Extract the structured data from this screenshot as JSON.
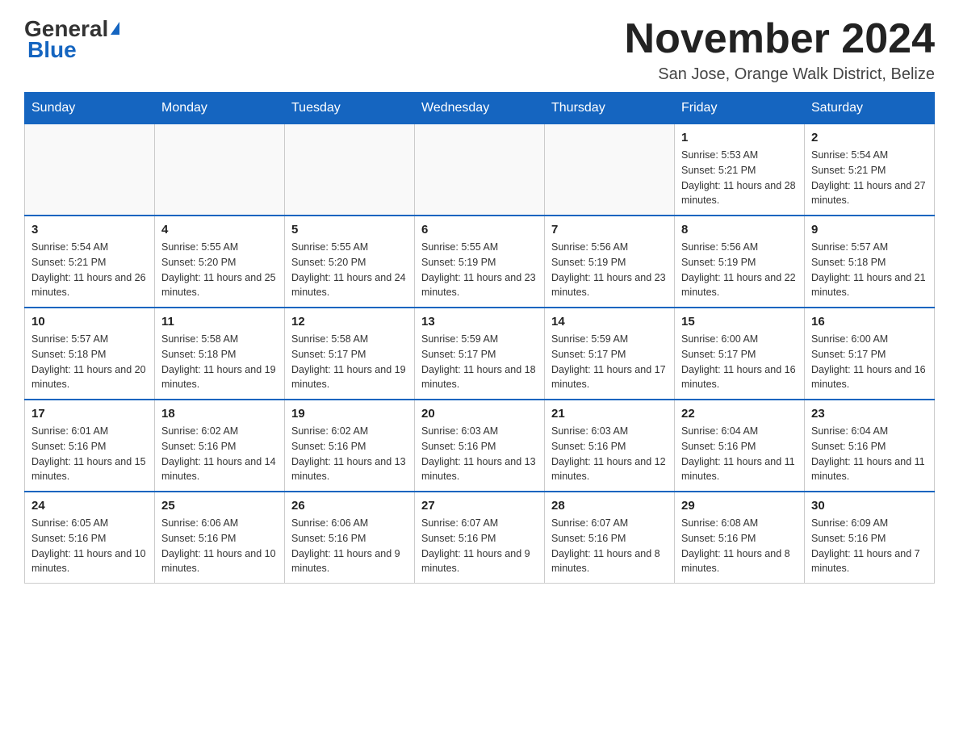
{
  "logo": {
    "general": "General",
    "triangle_char": "▶",
    "blue": "Blue"
  },
  "header": {
    "month_title": "November 2024",
    "subtitle": "San Jose, Orange Walk District, Belize"
  },
  "weekdays": [
    "Sunday",
    "Monday",
    "Tuesday",
    "Wednesday",
    "Thursday",
    "Friday",
    "Saturday"
  ],
  "weeks": [
    [
      {
        "day": "",
        "info": ""
      },
      {
        "day": "",
        "info": ""
      },
      {
        "day": "",
        "info": ""
      },
      {
        "day": "",
        "info": ""
      },
      {
        "day": "",
        "info": ""
      },
      {
        "day": "1",
        "info": "Sunrise: 5:53 AM\nSunset: 5:21 PM\nDaylight: 11 hours and 28 minutes."
      },
      {
        "day": "2",
        "info": "Sunrise: 5:54 AM\nSunset: 5:21 PM\nDaylight: 11 hours and 27 minutes."
      }
    ],
    [
      {
        "day": "3",
        "info": "Sunrise: 5:54 AM\nSunset: 5:21 PM\nDaylight: 11 hours and 26 minutes."
      },
      {
        "day": "4",
        "info": "Sunrise: 5:55 AM\nSunset: 5:20 PM\nDaylight: 11 hours and 25 minutes."
      },
      {
        "day": "5",
        "info": "Sunrise: 5:55 AM\nSunset: 5:20 PM\nDaylight: 11 hours and 24 minutes."
      },
      {
        "day": "6",
        "info": "Sunrise: 5:55 AM\nSunset: 5:19 PM\nDaylight: 11 hours and 23 minutes."
      },
      {
        "day": "7",
        "info": "Sunrise: 5:56 AM\nSunset: 5:19 PM\nDaylight: 11 hours and 23 minutes."
      },
      {
        "day": "8",
        "info": "Sunrise: 5:56 AM\nSunset: 5:19 PM\nDaylight: 11 hours and 22 minutes."
      },
      {
        "day": "9",
        "info": "Sunrise: 5:57 AM\nSunset: 5:18 PM\nDaylight: 11 hours and 21 minutes."
      }
    ],
    [
      {
        "day": "10",
        "info": "Sunrise: 5:57 AM\nSunset: 5:18 PM\nDaylight: 11 hours and 20 minutes."
      },
      {
        "day": "11",
        "info": "Sunrise: 5:58 AM\nSunset: 5:18 PM\nDaylight: 11 hours and 19 minutes."
      },
      {
        "day": "12",
        "info": "Sunrise: 5:58 AM\nSunset: 5:17 PM\nDaylight: 11 hours and 19 minutes."
      },
      {
        "day": "13",
        "info": "Sunrise: 5:59 AM\nSunset: 5:17 PM\nDaylight: 11 hours and 18 minutes."
      },
      {
        "day": "14",
        "info": "Sunrise: 5:59 AM\nSunset: 5:17 PM\nDaylight: 11 hours and 17 minutes."
      },
      {
        "day": "15",
        "info": "Sunrise: 6:00 AM\nSunset: 5:17 PM\nDaylight: 11 hours and 16 minutes."
      },
      {
        "day": "16",
        "info": "Sunrise: 6:00 AM\nSunset: 5:17 PM\nDaylight: 11 hours and 16 minutes."
      }
    ],
    [
      {
        "day": "17",
        "info": "Sunrise: 6:01 AM\nSunset: 5:16 PM\nDaylight: 11 hours and 15 minutes."
      },
      {
        "day": "18",
        "info": "Sunrise: 6:02 AM\nSunset: 5:16 PM\nDaylight: 11 hours and 14 minutes."
      },
      {
        "day": "19",
        "info": "Sunrise: 6:02 AM\nSunset: 5:16 PM\nDaylight: 11 hours and 13 minutes."
      },
      {
        "day": "20",
        "info": "Sunrise: 6:03 AM\nSunset: 5:16 PM\nDaylight: 11 hours and 13 minutes."
      },
      {
        "day": "21",
        "info": "Sunrise: 6:03 AM\nSunset: 5:16 PM\nDaylight: 11 hours and 12 minutes."
      },
      {
        "day": "22",
        "info": "Sunrise: 6:04 AM\nSunset: 5:16 PM\nDaylight: 11 hours and 11 minutes."
      },
      {
        "day": "23",
        "info": "Sunrise: 6:04 AM\nSunset: 5:16 PM\nDaylight: 11 hours and 11 minutes."
      }
    ],
    [
      {
        "day": "24",
        "info": "Sunrise: 6:05 AM\nSunset: 5:16 PM\nDaylight: 11 hours and 10 minutes."
      },
      {
        "day": "25",
        "info": "Sunrise: 6:06 AM\nSunset: 5:16 PM\nDaylight: 11 hours and 10 minutes."
      },
      {
        "day": "26",
        "info": "Sunrise: 6:06 AM\nSunset: 5:16 PM\nDaylight: 11 hours and 9 minutes."
      },
      {
        "day": "27",
        "info": "Sunrise: 6:07 AM\nSunset: 5:16 PM\nDaylight: 11 hours and 9 minutes."
      },
      {
        "day": "28",
        "info": "Sunrise: 6:07 AM\nSunset: 5:16 PM\nDaylight: 11 hours and 8 minutes."
      },
      {
        "day": "29",
        "info": "Sunrise: 6:08 AM\nSunset: 5:16 PM\nDaylight: 11 hours and 8 minutes."
      },
      {
        "day": "30",
        "info": "Sunrise: 6:09 AM\nSunset: 5:16 PM\nDaylight: 11 hours and 7 minutes."
      }
    ]
  ]
}
